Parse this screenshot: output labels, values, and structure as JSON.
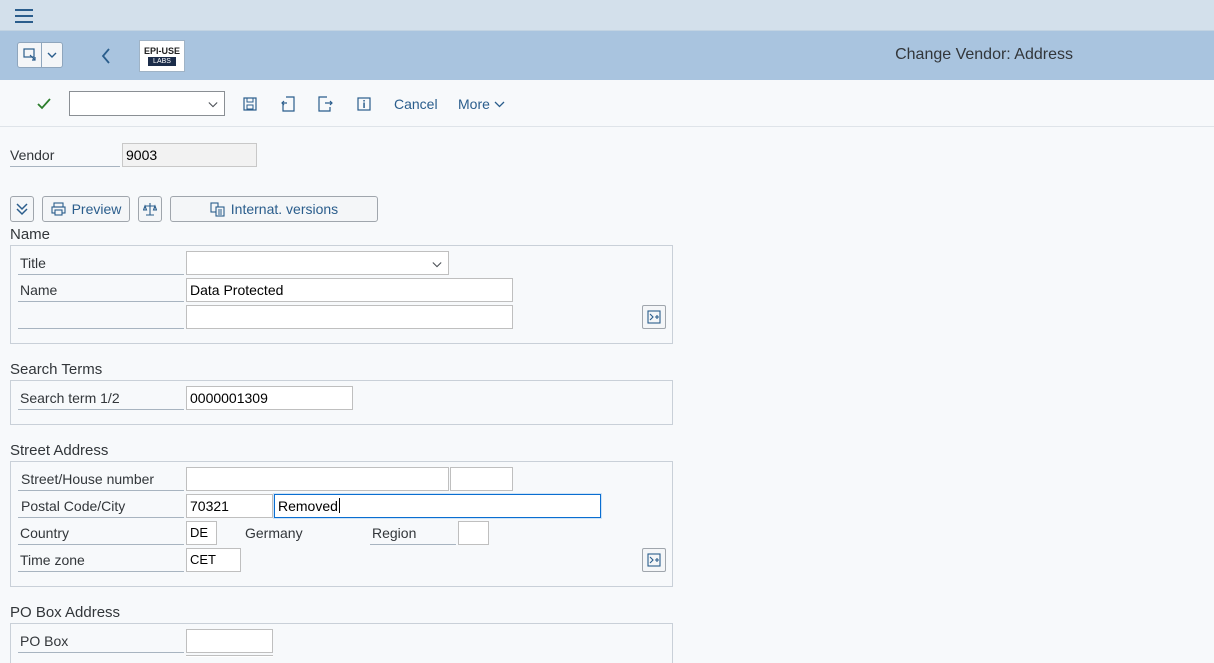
{
  "header": {
    "title": "Change Vendor: Address",
    "logo_text_top": "EPI-USE",
    "logo_text_bottom": "LABS"
  },
  "toolbar": {
    "command_field_value": "",
    "cancel_label": "Cancel",
    "more_label": "More"
  },
  "vendor": {
    "label": "Vendor",
    "value": "9003"
  },
  "buttons": {
    "preview_label": "Preview",
    "internat_label": "Internat. versions"
  },
  "name_group": {
    "title": "Name",
    "title_label": "Title",
    "title_value": "",
    "name_label": "Name",
    "name_value": "Data Protected",
    "name2_value": ""
  },
  "search_group": {
    "title": "Search Terms",
    "label": "Search term 1/2",
    "value": "0000001309"
  },
  "street_group": {
    "title": "Street Address",
    "street_label": "Street/House number",
    "street_value": "",
    "house_value": "",
    "postal_label": "Postal Code/City",
    "postal_value": "70321",
    "city_value": "Removed",
    "country_label": "Country",
    "country_value": "DE",
    "country_name": "Germany",
    "region_label": "Region",
    "region_value": "",
    "timezone_label": "Time zone",
    "timezone_value": "CET"
  },
  "pobox_group": {
    "title": "PO Box Address",
    "label": "PO Box",
    "value": ""
  },
  "colors": {
    "shell_bg": "#a9c4df",
    "menubar_bg": "#d3e0eb",
    "accent": "#2a5d8c",
    "check_green": "#2b7d2b"
  }
}
